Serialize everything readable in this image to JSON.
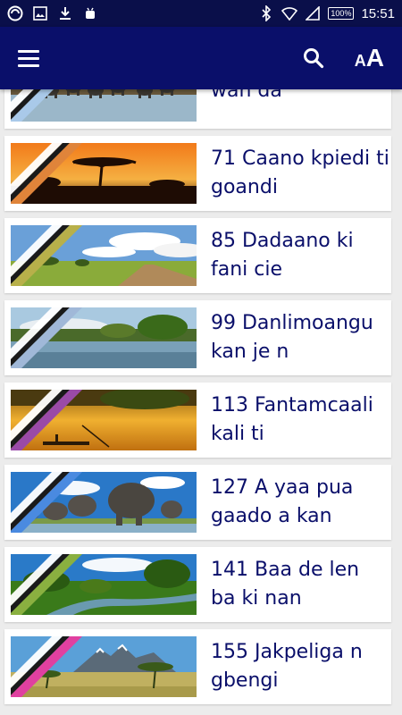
{
  "status_bar": {
    "time": "15:51",
    "battery": "100%",
    "left_icons": [
      "app-notification-icon",
      "image-icon",
      "download-icon",
      "android-icon"
    ],
    "right_icons": [
      "bluetooth-icon",
      "wifi-icon",
      "signal-icon",
      "battery-icon"
    ]
  },
  "app_bar": {
    "menu_icon": "hamburger-menu-icon",
    "search_icon": "search-icon",
    "font_size_label_small": "A",
    "font_size_label_big": "A"
  },
  "colors": {
    "status_bar": "#0a0f4a",
    "app_bar": "#0a0f6a",
    "title_text": "#0a0f6a",
    "background": "#ececec"
  },
  "items": [
    {
      "title": "wan da",
      "scene": "elephants-river",
      "stripe": "#a9c9e9"
    },
    {
      "title": "71 Caano kpiedi ti goandi",
      "scene": "sunset-savanna",
      "stripe": "#e0843a"
    },
    {
      "title": "85 Dadaano ki fani cie",
      "scene": "savanna-road",
      "stripe": "#b8b04a"
    },
    {
      "title": "99 Danlimoangu kan je n",
      "scene": "river-trees",
      "stripe": "#a0b8d8"
    },
    {
      "title": "113 Fantamcaali kali ti",
      "scene": "golden-lake-canoe",
      "stripe": "#9a4aa8"
    },
    {
      "title": "127 A yaa pua gaado a kan",
      "scene": "elephant-herd",
      "stripe": "#4a8ae0"
    },
    {
      "title": "141 Baa de len ba ki nan",
      "scene": "green-river",
      "stripe": "#8ab040"
    },
    {
      "title": "155 Jakpeliga n gbengi",
      "scene": "mountain-acacia",
      "stripe": "#e040a0"
    }
  ]
}
